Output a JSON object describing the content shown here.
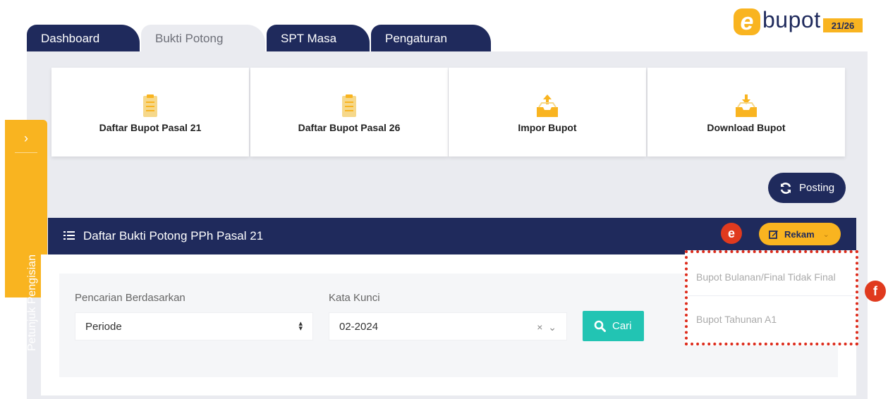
{
  "tabs": [
    {
      "label": "Dashboard"
    },
    {
      "label": "Bukti Potong"
    },
    {
      "label": "SPT Masa"
    },
    {
      "label": "Pengaturan"
    }
  ],
  "logo": {
    "letter": "e",
    "text": "bupot",
    "badge": "21/26"
  },
  "cards": [
    {
      "label": "Daftar Bupot Pasal 21",
      "icon": "clipboard-icon"
    },
    {
      "label": "Daftar Bupot Pasal 26",
      "icon": "clipboard-icon"
    },
    {
      "label": "Impor Bupot",
      "icon": "tray-upload-icon"
    },
    {
      "label": "Download Bupot",
      "icon": "tray-download-icon"
    }
  ],
  "sidebar": {
    "label": "Petunjuk Pengisian",
    "chevron": "›"
  },
  "posting": {
    "label": "Posting"
  },
  "list": {
    "title": "Daftar Bukti Potong PPh Pasal 21"
  },
  "rekam": {
    "label": "Rekam"
  },
  "badges": {
    "e": "e",
    "f": "f"
  },
  "filter": {
    "search_by_label": "Pencarian Berdasarkan",
    "search_by_value": "Periode",
    "keyword_label": "Kata Kunci",
    "keyword_value": "02-2024",
    "search_button": "Cari"
  },
  "dropdown": {
    "items": [
      "Bupot Bulanan/Final Tidak Final",
      "Bupot Tahunan A1"
    ]
  },
  "colors": {
    "navy": "#1f2a5c",
    "yellow": "#f9b420",
    "teal": "#22c4b3",
    "red": "#e03a1e"
  }
}
